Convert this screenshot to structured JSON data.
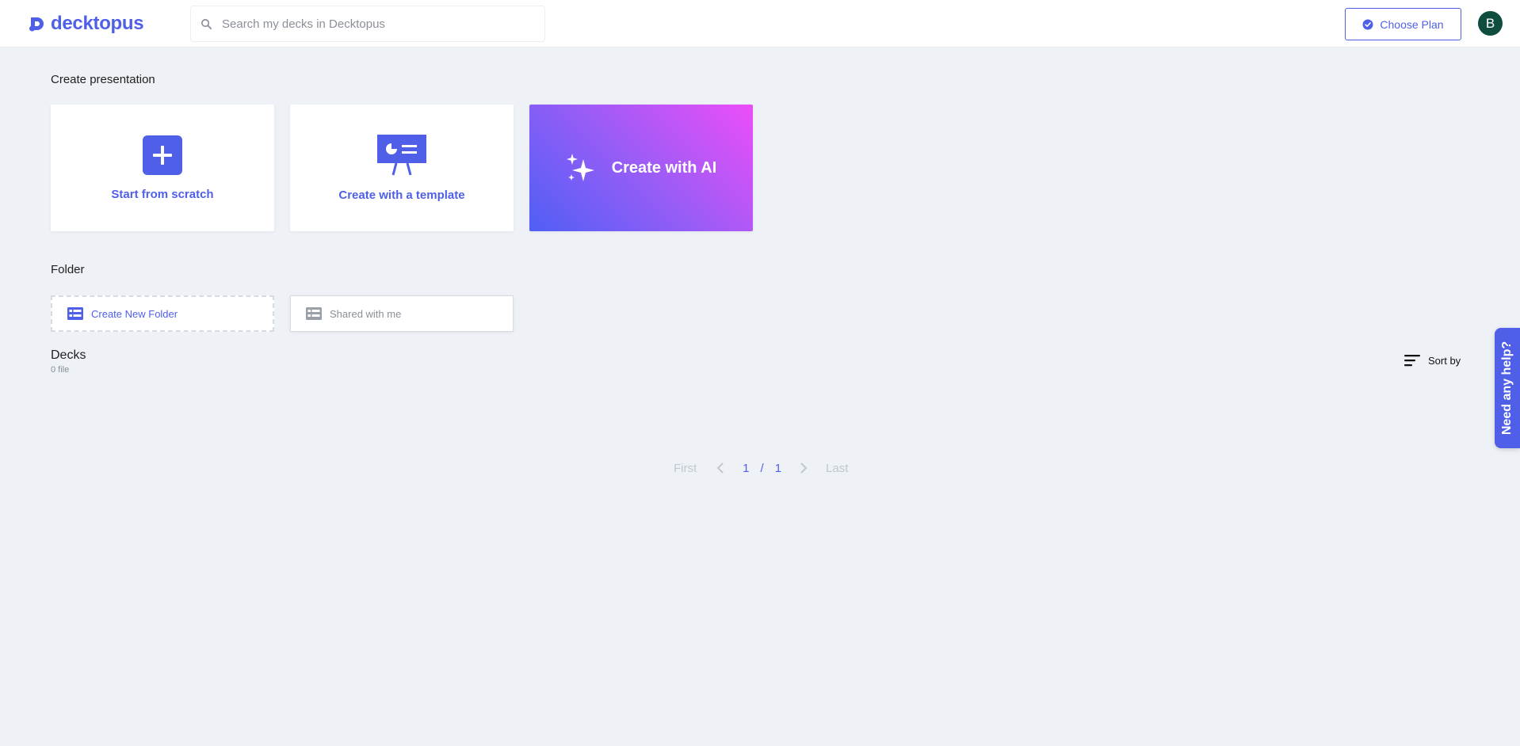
{
  "header": {
    "logo_text": "decktopus",
    "search_placeholder": "Search my decks in Decktopus",
    "plan_button": "Choose Plan",
    "avatar_initial": "B"
  },
  "create": {
    "title": "Create presentation",
    "scratch_label": "Start from scratch",
    "template_label": "Create with a template",
    "ai_label": "Create with AI"
  },
  "folder": {
    "title": "Folder",
    "new_label": "Create New Folder",
    "shared_label": "Shared with me"
  },
  "decks": {
    "title": "Decks",
    "count": "0 file",
    "sort_label": "Sort by"
  },
  "pagination": {
    "first": "First",
    "current": "1",
    "separator": "/",
    "total": "1",
    "last": "Last"
  },
  "help": {
    "label": "Need any help?"
  },
  "colors": {
    "brand": "#4f5fe8",
    "background": "#eef1f6",
    "avatar": "#0f4d3e"
  }
}
